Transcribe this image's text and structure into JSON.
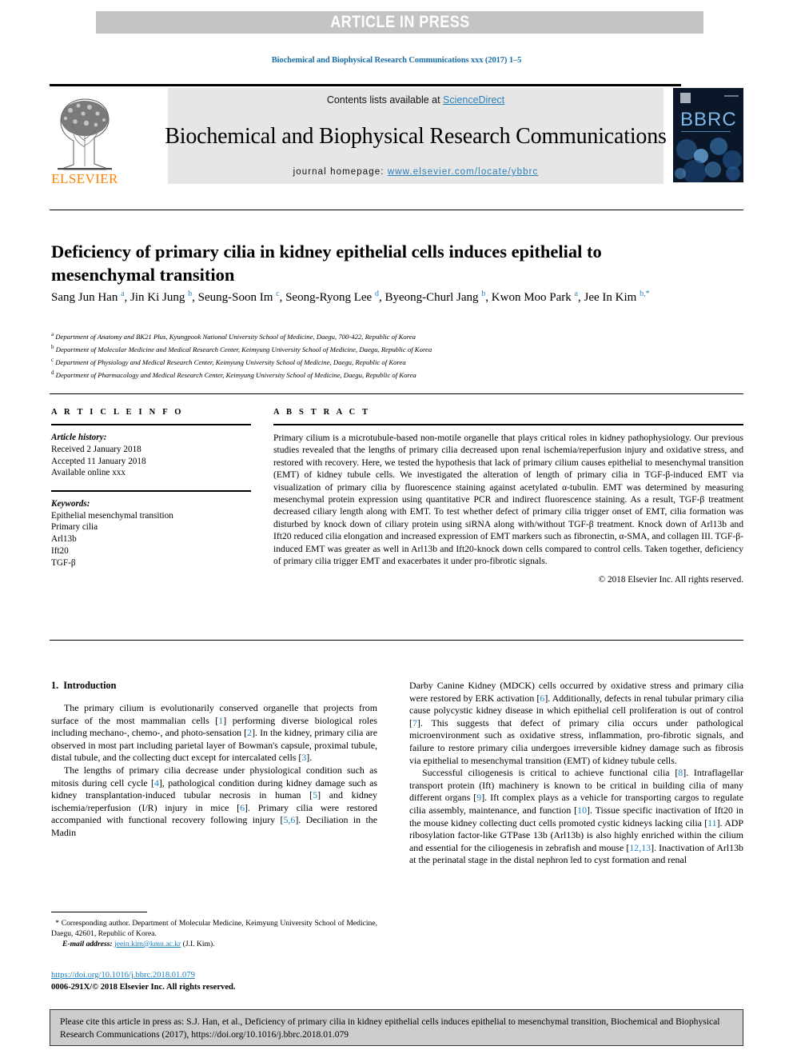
{
  "banner": {
    "label": "ARTICLE IN PRESS"
  },
  "running_head": "Biochemical and Biophysical Research Communications xxx (2017) 1–5",
  "masthead": {
    "contents_prefix": "Contents lists available at ",
    "sciencedirect": "ScienceDirect",
    "journal_title": "Biochemical and Biophysical Research Communications",
    "homepage_prefix": "journal homepage: ",
    "homepage_url": "www.elsevier.com/locate/ybbrc",
    "publisher_logo_label": "ELSEVIER",
    "cover_label": "BBRC"
  },
  "article": {
    "title": "Deficiency of primary cilia in kidney epithelial cells induces epithelial to mesenchymal transition",
    "authors_html": "Sang Jun Han <sup>a</sup>, Jin Ki Jung <sup>b</sup>, Seung-Soon Im <sup>c</sup>, Seong-Ryong Lee <sup>d</sup>, Byeong-Churl Jang <sup>b</sup>, Kwon Moo Park <sup>a</sup>, Jee In Kim <sup>b,*</sup>",
    "affiliations": [
      {
        "marker": "a",
        "text": "Department of Anatomy and BK21 Plus, Kyungpook National University School of Medicine, Daegu, 700-422, Republic of Korea"
      },
      {
        "marker": "b",
        "text": "Department of Molecular Medicine and Medical Research Center, Keimyung University School of Medicine, Daegu, Republic of Korea"
      },
      {
        "marker": "c",
        "text": "Department of Physiology and Medical Research Center, Keimyung University School of Medicine, Daegu, Republic of Korea"
      },
      {
        "marker": "d",
        "text": "Department of Pharmacology and Medical Research Center, Keimyung University School of Medicine, Daegu, Republic of Korea"
      }
    ]
  },
  "article_info": {
    "heading": "A R T I C L E  I N F O",
    "history_label": "Article history:",
    "history": [
      "Received 2 January 2018",
      "Accepted 11 January 2018",
      "Available online xxx"
    ],
    "keywords_label": "Keywords:",
    "keywords": [
      "Epithelial mesenchymal transition",
      "Primary cilia",
      "Arl13b",
      "Ift20",
      "TGF-β"
    ]
  },
  "abstract": {
    "heading": "A B S T R A C T",
    "text": "Primary cilium is a microtubule-based non-motile organelle that plays critical roles in kidney pathophysiology. Our previous studies revealed that the lengths of primary cilia decreased upon renal ischemia/reperfusion injury and oxidative stress, and restored with recovery. Here, we tested the hypothesis that lack of primary cilium causes epithelial to mesenchymal transition (EMT) of kidney tubule cells. We investigated the alteration of length of primary cilia in TGF-β-induced EMT via visualization of primary cilia by fluorescence staining against acetylated α-tubulin. EMT was determined by measuring mesenchymal protein expression using quantitative PCR and indirect fluorescence staining. As a result, TGF-β treatment decreased ciliary length along with EMT. To test whether defect of primary cilia trigger onset of EMT, cilia formation was disturbed by knock down of ciliary protein using siRNA along with/without TGF-β treatment. Knock down of Arl13b and Ift20 reduced cilia elongation and increased expression of EMT markers such as fibronectin, α-SMA, and collagen III. TGF-β-induced EMT was greater as well in Arl13b and Ift20-knock down cells compared to control cells. Taken together, deficiency of primary cilia trigger EMT and exacerbates it under pro-fibrotic signals.",
    "copyright": "© 2018 Elsevier Inc. All rights reserved."
  },
  "introduction": {
    "section_number": "1.",
    "section_title": "Introduction",
    "left_paragraphs": [
      "The primary cilium is evolutionarily conserved organelle that projects from surface of the most mammalian cells [1] performing diverse biological roles including mechano-, chemo-, and photo-sensation [2]. In the kidney, primary cilia are observed in most part including parietal layer of Bowman's capsule, proximal tubule, distal tubule, and the collecting duct except for intercalated cells [3].",
      "The lengths of primary cilia decrease under physiological condition such as mitosis during cell cycle [4], pathological condition during kidney damage such as kidney transplantation-induced tubular necrosis in human [5] and kidney ischemia/reperfusion (I/R) injury in mice [6]. Primary cilia were restored accompanied with functional recovery following injury [5,6]. Deciliation in the Madin"
    ],
    "right_paragraphs": [
      "Darby Canine Kidney (MDCK) cells occurred by oxidative stress and primary cilia were restored by ERK activation [6]. Additionally, defects in renal tubular primary cilia cause polycystic kidney disease in which epithelial cell proliferation is out of control [7]. This suggests that defect of primary cilia occurs under pathological microenvironment such as oxidative stress, inflammation, pro-fibrotic signals, and failure to restore primary cilia undergoes irreversible kidney damage such as fibrosis via epithelial to mesenchymal transition (EMT) of kidney tubule cells.",
      "Successful ciliogenesis is critical to achieve functional cilia [8]. Intraflagellar transport protein (Ift) machinery is known to be critical in building cilia of many different organs [9]. Ift complex plays as a vehicle for transporting cargos to regulate cilia assembly, maintenance, and function [10]. Tissue specific inactivation of Ift20 in the mouse kidney collecting duct cells promoted cystic kidneys lacking cilia [11]. ADP ribosylation factor-like GTPase 13b (Arl13b) is also highly enriched within the cilium and essential for the ciliogenesis in zebrafish and mouse [12,13]. Inactivation of Arl13b at the perinatal stage in the distal nephron led to cyst formation and renal"
    ]
  },
  "footnote": {
    "corresponding": "Corresponding author. Department of Molecular Medicine, Keimyung University School of Medicine, Daegu, 42601, Republic of Korea.",
    "email_label": "E-mail address:",
    "email": "jeein.kim@kmu.ac.kr",
    "email_owner": "(J.I. Kim)."
  },
  "doi_block": {
    "doi_url": "https://doi.org/10.1016/j.bbrc.2018.01.079",
    "issn_line": "0006-291X/© 2018 Elsevier Inc. All rights reserved."
  },
  "citation_box": {
    "text": "Please cite this article in press as: S.J. Han, et al., Deficiency of primary cilia in kidney epithelial cells induces epithelial to mesenchymal transition, Biochemical and Biophysical Research Communications (2017), https://doi.org/10.1016/j.bbrc.2018.01.079"
  },
  "colors": {
    "link": "#1a7fc1",
    "banner_bg": "#c4c4c4",
    "masthead_bg": "#e6e6e6",
    "elsevier_orange": "#ff8200",
    "cover_navy": "#0a1729",
    "cite_bg": "#cccccc"
  }
}
